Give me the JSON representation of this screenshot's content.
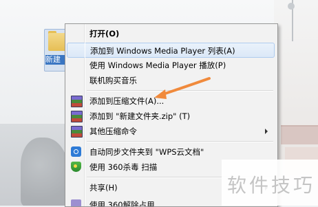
{
  "desktop": {
    "folder_label": "新建",
    "accent": "#3a76c2"
  },
  "menu": {
    "items": [
      {
        "label": "打开(O)",
        "bold": true
      },
      {
        "label": "添加到 Windows Media Player 列表(A)",
        "highlighted": true
      },
      {
        "label": "使用 Windows Media Player 播放(P)"
      },
      {
        "label": "联机购买音乐"
      },
      {
        "label": "添加到压缩文件(A)...",
        "icon": "winrar-icon"
      },
      {
        "label": "添加到 \"新建文件夹.zip\" (T)",
        "icon": "winrar-icon"
      },
      {
        "label": "其他压缩命令",
        "icon": "winrar-icon",
        "submenu": true
      },
      {
        "label": "自动同步文件夹到 \"WPS云文档\"",
        "icon": "sync-icon"
      },
      {
        "label": "使用 360杀毒 扫描",
        "icon": "shield-icon"
      },
      {
        "label": "共享(H)",
        "submenu": true
      },
      {
        "label": "使用 360解除占用",
        "icon": "app-icon"
      }
    ],
    "highlight_color": "#dbe8f7"
  },
  "annotation": {
    "arrow_color": "#f08a3c"
  },
  "watermark": {
    "text": "软件技巧"
  }
}
